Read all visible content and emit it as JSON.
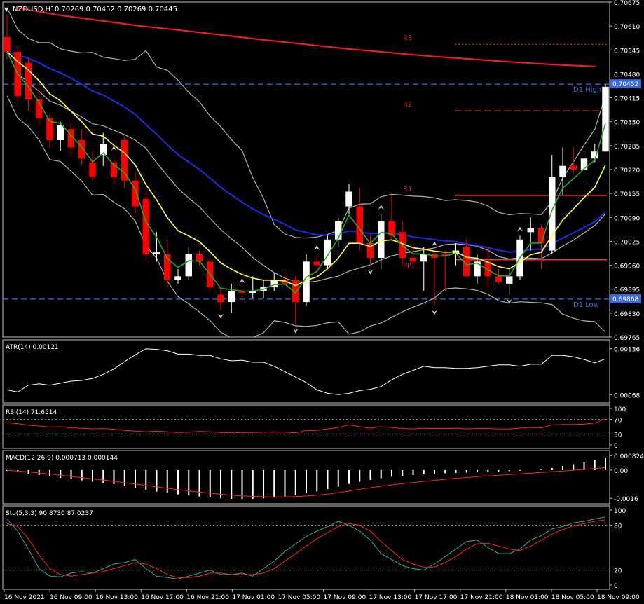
{
  "symbol_label": "NZDUSD,H1",
  "ohlc_text": "0.70269 0.70452 0.70269 0.70445",
  "colors": {
    "background": "#000000",
    "frame": "#c0c0c0",
    "bull_candle": "#ffffff",
    "bear_candle": "#ff0000",
    "ma_fast": "#22aa22",
    "ma_mid": "#ffff33",
    "ma_slow": "#1a2be8",
    "ma_long": "#ff1a1a",
    "bands": "#b0b0b0",
    "pivot_lines": "#ff3030",
    "d1_lines": "#3a6ad8",
    "indicator_line": "#ffffff",
    "signal_line": "#ff2020",
    "sto_main": "#20b090",
    "fractal_arrow": "#c8c8c8"
  },
  "price_axis": {
    "min": 0.69765,
    "max": 0.70675,
    "ticks": [
      "0.70675",
      "0.70610",
      "0.70545",
      "0.70480",
      "0.70415",
      "0.70350",
      "0.70285",
      "0.70220",
      "0.70155",
      "0.70090",
      "0.70025",
      "0.69960",
      "0.69895",
      "0.69830",
      "0.69765"
    ]
  },
  "current_price": {
    "label": "0.70452",
    "value": 0.70452
  },
  "d1_low_tag": {
    "label": "0.69868",
    "value": 0.69868
  },
  "levels": [
    {
      "name": "R3",
      "label": "R3",
      "value": 0.7056,
      "style": "dotted",
      "start": 0.745
    },
    {
      "name": "R2",
      "label": "R2",
      "value": 0.7038,
      "style": "dashed",
      "start": 0.745
    },
    {
      "name": "R1",
      "label": "R1",
      "value": 0.7015,
      "style": "solid",
      "start": 0.745
    },
    {
      "name": "PP",
      "label": "PP",
      "value": 0.69975,
      "style": "solid",
      "start": 0.745
    },
    {
      "name": "D1 High",
      "label": "D1 High",
      "value": 0.70452,
      "style": "dashed-blue",
      "start": 0
    },
    {
      "name": "D1 Low",
      "label": "D1 Low",
      "value": 0.69868,
      "style": "dashed-blue",
      "start": 0
    }
  ],
  "time_axis": [
    "16 Nov 2021",
    "16 Nov 09:00",
    "16 Nov 13:00",
    "16 Nov 17:00",
    "16 Nov 21:00",
    "17 Nov 01:00",
    "17 Nov 05:00",
    "17 Nov 09:00",
    "17 Nov 13:00",
    "17 Nov 17:00",
    "17 Nov 21:00",
    "18 Nov 01:00",
    "18 Nov 05:00",
    "18 Nov 09:00"
  ],
  "chart_data": {
    "type": "candlestick",
    "timeframe": "H1",
    "candles": [
      {
        "o": 0.7058,
        "h": 0.7064,
        "l": 0.7052,
        "c": 0.7054
      },
      {
        "o": 0.7054,
        "h": 0.70555,
        "l": 0.704,
        "c": 0.7042
      },
      {
        "o": 0.7051,
        "h": 0.7052,
        "l": 0.7038,
        "c": 0.7041
      },
      {
        "o": 0.7041,
        "h": 0.7044,
        "l": 0.7034,
        "c": 0.7036
      },
      {
        "o": 0.7036,
        "h": 0.7037,
        "l": 0.7028,
        "c": 0.703
      },
      {
        "o": 0.703,
        "h": 0.7035,
        "l": 0.7027,
        "c": 0.7034
      },
      {
        "o": 0.7033,
        "h": 0.7035,
        "l": 0.7026,
        "c": 0.7028
      },
      {
        "o": 0.703,
        "h": 0.7033,
        "l": 0.7023,
        "c": 0.7025
      },
      {
        "o": 0.7024,
        "h": 0.7027,
        "l": 0.7019,
        "c": 0.702
      },
      {
        "o": 0.7026,
        "h": 0.7032,
        "l": 0.7023,
        "c": 0.7029
      },
      {
        "o": 0.7024,
        "h": 0.7026,
        "l": 0.7018,
        "c": 0.702
      },
      {
        "o": 0.703,
        "h": 0.7031,
        "l": 0.7017,
        "c": 0.7019
      },
      {
        "o": 0.7019,
        "h": 0.7021,
        "l": 0.701,
        "c": 0.7012
      },
      {
        "o": 0.7014,
        "h": 0.7016,
        "l": 0.6997,
        "c": 0.6999
      },
      {
        "o": 0.6999,
        "h": 0.7005,
        "l": 0.6997,
        "c": 0.69995
      },
      {
        "o": 0.6999,
        "h": 0.7003,
        "l": 0.699,
        "c": 0.6992
      },
      {
        "o": 0.6992,
        "h": 0.6995,
        "l": 0.6991,
        "c": 0.6993
      },
      {
        "o": 0.6993,
        "h": 0.7001,
        "l": 0.6992,
        "c": 0.6999
      },
      {
        "o": 0.6999,
        "h": 0.7,
        "l": 0.6996,
        "c": 0.6997
      },
      {
        "o": 0.6997,
        "h": 0.6998,
        "l": 0.6989,
        "c": 0.699
      },
      {
        "o": 0.6988,
        "h": 0.699,
        "l": 0.6984,
        "c": 0.6986
      },
      {
        "o": 0.6986,
        "h": 0.6991,
        "l": 0.6983,
        "c": 0.6989
      },
      {
        "o": 0.6989,
        "h": 0.699,
        "l": 0.6987,
        "c": 0.69885
      },
      {
        "o": 0.69885,
        "h": 0.6993,
        "l": 0.6987,
        "c": 0.6989
      },
      {
        "o": 0.6989,
        "h": 0.6992,
        "l": 0.6987,
        "c": 0.699
      },
      {
        "o": 0.699,
        "h": 0.6994,
        "l": 0.6989,
        "c": 0.6992
      },
      {
        "o": 0.6992,
        "h": 0.6994,
        "l": 0.699,
        "c": 0.6991
      },
      {
        "o": 0.6992,
        "h": 0.6993,
        "l": 0.698,
        "c": 0.6986
      },
      {
        "o": 0.6986,
        "h": 0.6999,
        "l": 0.6985,
        "c": 0.6997
      },
      {
        "o": 0.6997,
        "h": 0.6999,
        "l": 0.6995,
        "c": 0.6996
      },
      {
        "o": 0.6996,
        "h": 0.7004,
        "l": 0.6995,
        "c": 0.7003
      },
      {
        "o": 0.7003,
        "h": 0.7009,
        "l": 0.7001,
        "c": 0.7008
      },
      {
        "o": 0.7012,
        "h": 0.7018,
        "l": 0.701,
        "c": 0.7016
      },
      {
        "o": 0.7012,
        "h": 0.7017,
        "l": 0.7,
        "c": 0.7002
      },
      {
        "o": 0.7002,
        "h": 0.7004,
        "l": 0.6996,
        "c": 0.6998
      },
      {
        "o": 0.6998,
        "h": 0.701,
        "l": 0.6995,
        "c": 0.7008
      },
      {
        "o": 0.7008,
        "h": 0.7015,
        "l": 0.7003,
        "c": 0.7004
      },
      {
        "o": 0.7005,
        "h": 0.7008,
        "l": 0.6996,
        "c": 0.6998
      },
      {
        "o": 0.6998,
        "h": 0.7002,
        "l": 0.6995,
        "c": 0.6997
      },
      {
        "o": 0.6997,
        "h": 0.7001,
        "l": 0.6989,
        "c": 0.6999
      },
      {
        "o": 0.6999,
        "h": 0.7,
        "l": 0.6985,
        "c": 0.6998
      },
      {
        "o": 0.6999,
        "h": 0.7,
        "l": 0.6989,
        "c": 0.69985
      },
      {
        "o": 0.6999,
        "h": 0.7002,
        "l": 0.6996,
        "c": 0.7
      },
      {
        "o": 0.7001,
        "h": 0.7003,
        "l": 0.6993,
        "c": 0.6993
      },
      {
        "o": 0.6993,
        "h": 0.6999,
        "l": 0.6991,
        "c": 0.6997
      },
      {
        "o": 0.6997,
        "h": 0.7001,
        "l": 0.699,
        "c": 0.6993
      },
      {
        "o": 0.6993,
        "h": 0.6995,
        "l": 0.6991,
        "c": 0.69915
      },
      {
        "o": 0.6991,
        "h": 0.6995,
        "l": 0.6988,
        "c": 0.6993
      },
      {
        "o": 0.6993,
        "h": 0.7004,
        "l": 0.6992,
        "c": 0.7003
      },
      {
        "o": 0.7005,
        "h": 0.7009,
        "l": 0.7,
        "c": 0.7006
      },
      {
        "o": 0.7006,
        "h": 0.7007,
        "l": 0.6995,
        "c": 0.7002
      },
      {
        "o": 0.7,
        "h": 0.7026,
        "l": 0.6999,
        "c": 0.702
      },
      {
        "o": 0.702,
        "h": 0.7028,
        "l": 0.7015,
        "c": 0.7023
      },
      {
        "o": 0.7023,
        "h": 0.7028,
        "l": 0.7021,
        "c": 0.7022
      },
      {
        "o": 0.7022,
        "h": 0.7026,
        "l": 0.7019,
        "c": 0.7025
      },
      {
        "o": 0.7025,
        "h": 0.7029,
        "l": 0.7024,
        "c": 0.70269
      },
      {
        "o": 0.70269,
        "h": 0.70452,
        "l": 0.70269,
        "c": 0.70445
      }
    ],
    "ma_long": [
      0.7066,
      0.7064,
      0.70625,
      0.7061,
      0.70598,
      0.70585,
      0.70572,
      0.7056,
      0.70548,
      0.70538,
      0.70528,
      0.7052,
      0.70512,
      0.70505,
      0.705
    ],
    "indicators": {
      "atr": {
        "label": "ATR(14) 0.00121",
        "max_tick": "0.00136",
        "min_tick": "0.00068",
        "min": 0.0006,
        "max": 0.00145,
        "values": [
          0.00075,
          0.00072,
          0.00082,
          0.00084,
          0.00082,
          0.00085,
          0.00088,
          0.00089,
          0.00092,
          0.00098,
          0.00106,
          0.00117,
          0.00127,
          0.00136,
          0.00135,
          0.00133,
          0.00128,
          0.00128,
          0.00126,
          0.00126,
          0.00121,
          0.00118,
          0.00119,
          0.00116,
          0.00116,
          0.0011,
          0.00102,
          0.00094,
          0.00086,
          0.00075,
          0.0007,
          0.00068,
          0.0007,
          0.00074,
          0.00076,
          0.0008,
          0.0009,
          0.00098,
          0.00104,
          0.0011,
          0.00108,
          0.00108,
          0.00107,
          0.00107,
          0.00108,
          0.0011,
          0.00112,
          0.00112,
          0.0011,
          0.00113,
          0.00113,
          0.00126,
          0.00126,
          0.00124,
          0.0012,
          0.00115,
          0.00121
        ]
      },
      "rsi": {
        "label": "RSI(14) 71.6514",
        "ticks": [
          "100",
          "70",
          "30",
          "0"
        ],
        "levels": [
          70,
          30
        ],
        "values": [
          61,
          58,
          54,
          52,
          49,
          50,
          47,
          46,
          44,
          45,
          43,
          40,
          38,
          36,
          38,
          36,
          34,
          35,
          37,
          36,
          34,
          33,
          34,
          34,
          35,
          36,
          35,
          33,
          40,
          40,
          44,
          48,
          55,
          50,
          46,
          50,
          48,
          45,
          44,
          46,
          45,
          45,
          46,
          44,
          45,
          45,
          44,
          44,
          46,
          48,
          47,
          55,
          56,
          56,
          57,
          60,
          71.65
        ]
      },
      "macd": {
        "label": "MACD(12,26,9) 0.000713 0.000144",
        "ticks": [
          "0.000824",
          "0.00",
          "-0.0016"
        ],
        "min": -0.00175,
        "max": 0.00095,
        "hist": [
          -5e-05,
          -0.00012,
          -0.0002,
          -0.00028,
          -0.00036,
          -0.00044,
          -0.00052,
          -0.00058,
          -0.00066,
          -0.00072,
          -0.0008,
          -0.0009,
          -0.001,
          -0.00112,
          -0.00122,
          -0.0013,
          -0.00138,
          -0.00144,
          -0.0015,
          -0.00155,
          -0.0016,
          -0.00163,
          -0.00164,
          -0.00163,
          -0.0016,
          -0.00156,
          -0.0015,
          -0.00143,
          -0.00132,
          -0.00121,
          -0.00108,
          -0.00094,
          -0.00078,
          -0.00066,
          -0.00056,
          -0.00046,
          -0.00038,
          -0.00032,
          -0.00028,
          -0.00024,
          -0.00021,
          -0.00018,
          -0.00016,
          -0.00014,
          -0.00012,
          -0.0001,
          -8e-05,
          -6e-05,
          -3e-05,
          0.0,
          3e-05,
          0.00012,
          0.00024,
          0.00034,
          0.00044,
          0.00056,
          0.00071
        ],
        "signal": [
          -2e-05,
          -5e-05,
          -0.0001,
          -0.00016,
          -0.00022,
          -0.00029,
          -0.00036,
          -0.00043,
          -0.0005,
          -0.00057,
          -0.00064,
          -0.00071,
          -0.00079,
          -0.00087,
          -0.00095,
          -0.00103,
          -0.00111,
          -0.00118,
          -0.00125,
          -0.00131,
          -0.00137,
          -0.00142,
          -0.00146,
          -0.00149,
          -0.00151,
          -0.00152,
          -0.00152,
          -0.0015,
          -0.00147,
          -0.00142,
          -0.00136,
          -0.00128,
          -0.00119,
          -0.00109,
          -0.001,
          -0.00092,
          -0.00084,
          -0.00077,
          -0.0007,
          -0.00064,
          -0.00058,
          -0.00052,
          -0.00047,
          -0.00042,
          -0.00037,
          -0.00033,
          -0.00029,
          -0.00025,
          -0.00021,
          -0.00017,
          -0.00013,
          -9e-05,
          -5e-05,
          -1e-05,
          4e-05,
          9e-05,
          0.00014
        ]
      },
      "sto": {
        "label": "Sto(5,3,3) 90.8730 87.0237",
        "ticks": [
          "100",
          "80",
          "20",
          "0"
        ],
        "levels": [
          80,
          20
        ],
        "main": [
          88,
          72,
          48,
          22,
          12,
          11,
          16,
          18,
          16,
          22,
          28,
          30,
          34,
          22,
          12,
          10,
          8,
          12,
          16,
          20,
          14,
          14,
          16,
          12,
          22,
          32,
          45,
          55,
          65,
          72,
          78,
          85,
          80,
          72,
          60,
          42,
          34,
          26,
          22,
          20,
          28,
          38,
          48,
          58,
          60,
          50,
          42,
          42,
          48,
          60,
          66,
          75,
          78,
          83,
          85,
          88,
          90.87
        ],
        "signal": [
          82,
          78,
          62,
          40,
          22,
          14,
          12,
          14,
          16,
          18,
          22,
          26,
          30,
          28,
          22,
          14,
          10,
          10,
          12,
          16,
          16,
          14,
          14,
          14,
          16,
          22,
          32,
          42,
          52,
          62,
          70,
          78,
          82,
          80,
          72,
          58,
          46,
          34,
          28,
          24,
          24,
          30,
          38,
          48,
          55,
          56,
          52,
          48,
          46,
          52,
          60,
          68,
          74,
          79,
          82,
          85,
          87.02
        ]
      }
    }
  }
}
